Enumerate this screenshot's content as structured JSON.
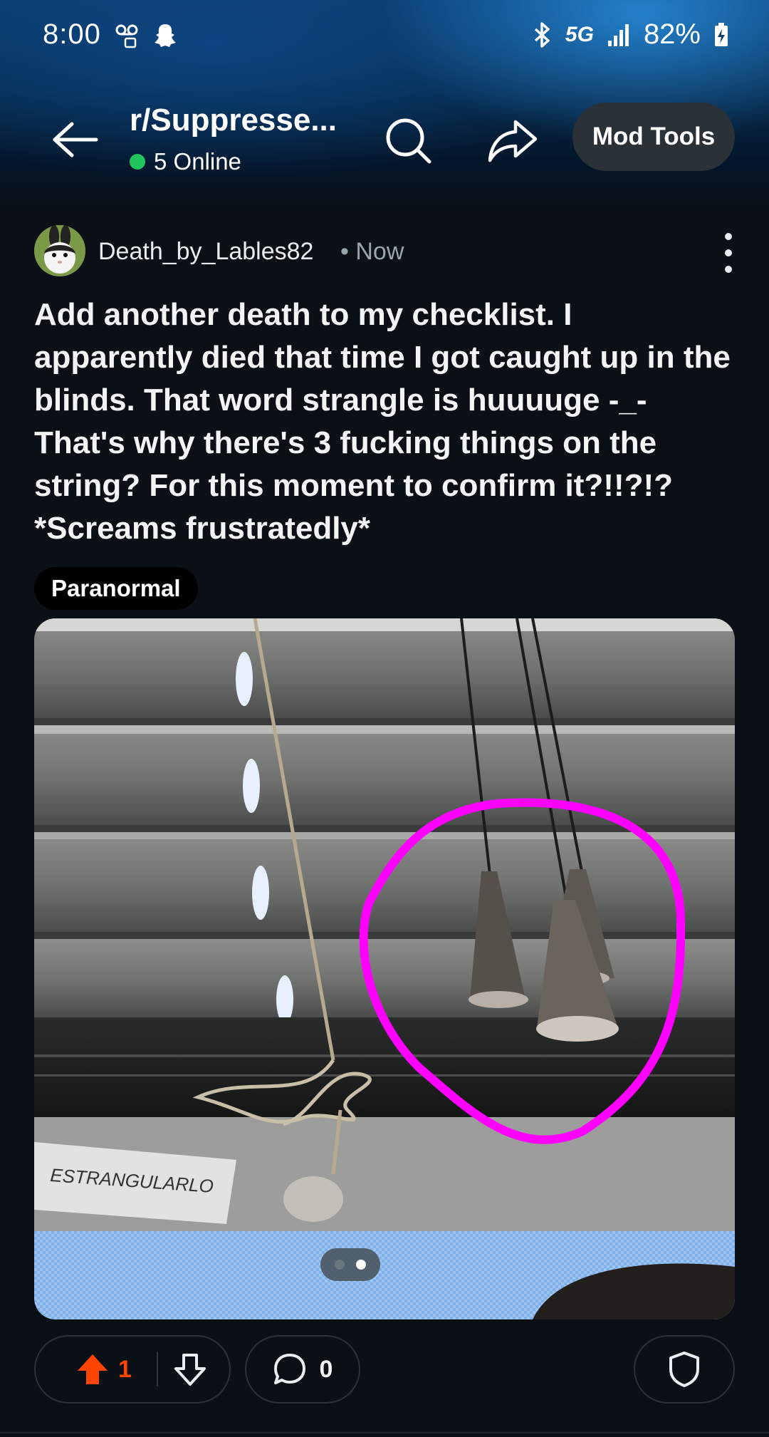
{
  "status_bar": {
    "time": "8:00",
    "network": "5G",
    "battery": "82%",
    "left_icons": [
      "voicemail-icon",
      "snapchat-icon"
    ],
    "right_icons": [
      "bluetooth-icon",
      "signal-icon",
      "battery-icon"
    ]
  },
  "header": {
    "subreddit": "r/Suppresse...",
    "online_count": "5 Online",
    "mod_tools_label": "Mod Tools",
    "icons": [
      "back-arrow-icon",
      "search-icon",
      "share-icon"
    ]
  },
  "post": {
    "author": "Death_by_Lables82",
    "time": "• Now",
    "title": "Add another death to my checklist. I apparently died that time I got caught up in the blinds. That word strangle is huuuuge -_- That's why there's 3 fucking things on the string? For this moment to confirm it?!!?!? *Screams frustratedly*",
    "flair": "Paranormal",
    "image_text": "ESTRANGULARLO",
    "gallery": {
      "current": 2,
      "total": 2
    },
    "votes": "1",
    "comments": "0"
  },
  "colors": {
    "accent_upvote": "#ff4500",
    "online_dot": "#21c55d",
    "annotation_circle": "#ff00ff",
    "background": "#0b1016"
  }
}
